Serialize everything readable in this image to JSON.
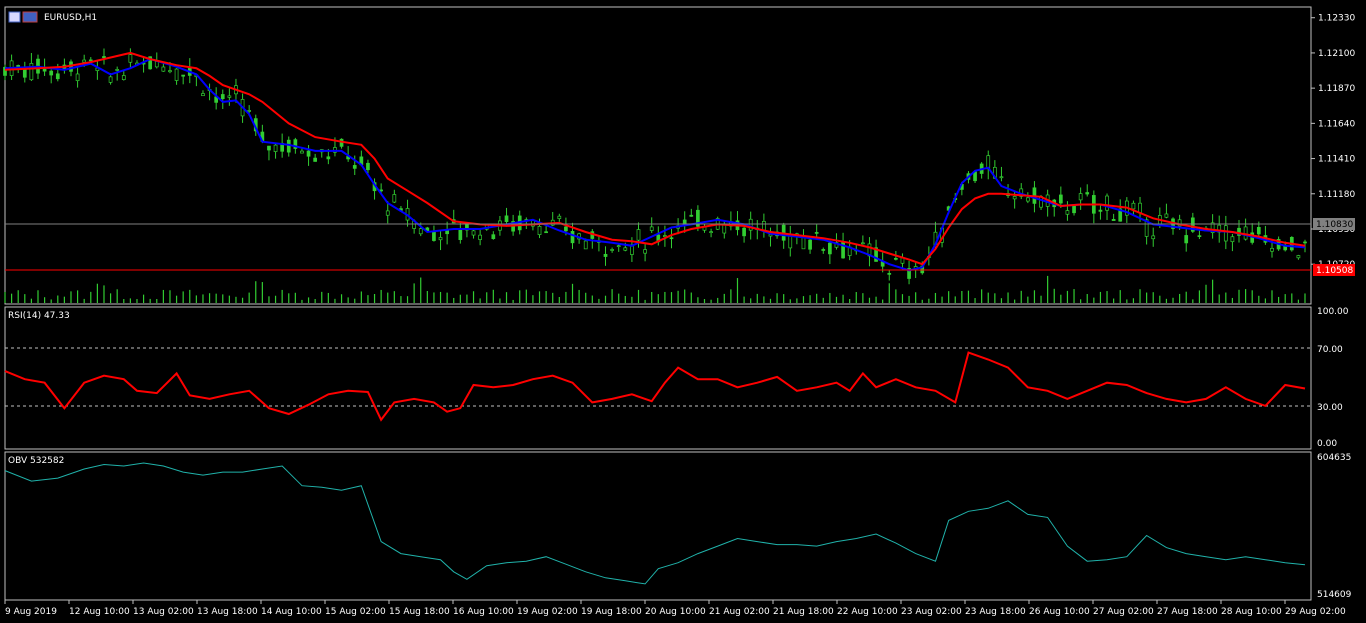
{
  "window": {
    "title": "EURUSD,H1"
  },
  "price_panel": {
    "price_ticks": [
      "1.12330",
      "1.12100",
      "1.11870",
      "1.11640",
      "1.11410",
      "1.11180",
      "1.10950",
      "1.10720"
    ],
    "current_bid_tag": "1.10830",
    "ask_line_tag": "1.10508"
  },
  "rsi_panel": {
    "label": "RSI(14) 47.33",
    "ticks": [
      "100.00",
      "70.00",
      "30.00",
      "0.00"
    ]
  },
  "obv_panel": {
    "label": "OBV 532582",
    "ticks": [
      "604635",
      "514609"
    ]
  },
  "time_axis": {
    "labels": [
      "9 Aug 2019",
      "12 Aug 10:00",
      "13 Aug 02:00",
      "13 Aug 18:00",
      "14 Aug 10:00",
      "15 Aug 02:00",
      "15 Aug 18:00",
      "16 Aug 10:00",
      "19 Aug 02:00",
      "19 Aug 18:00",
      "20 Aug 10:00",
      "21 Aug 02:00",
      "21 Aug 18:00",
      "22 Aug 10:00",
      "23 Aug 02:00",
      "23 Aug 18:00",
      "26 Aug 10:00",
      "27 Aug 02:00",
      "27 Aug 18:00",
      "28 Aug 10:00",
      "29 Aug 02:00"
    ]
  },
  "colors": {
    "background": "#000000",
    "candles": "#32cd32",
    "ma_fast": "#0000ff",
    "ma_slow": "#ff0000",
    "rsi_line": "#ff0000",
    "obv_line": "#20b2aa",
    "volume": "#32cd32",
    "bid_line": "#808080",
    "ask_line": "#ff0000"
  },
  "chart_data": [
    {
      "type": "line",
      "title": "EURUSD,H1",
      "ylim": [
        1.1046,
        1.124
      ],
      "series": [
        {
          "name": "",
          "points": [
            [
              0,
              1.12
            ],
            [
              5,
              1.1201
            ],
            [
              9,
              1.1199
            ],
            [
              13,
              1.1203
            ],
            [
              16,
              1.1196
            ],
            [
              19,
              1.12
            ],
            [
              22,
              1.1206
            ],
            [
              26,
              1.1201
            ],
            [
              29,
              1.1196
            ],
            [
              31,
              1.1186
            ],
            [
              33,
              1.1178
            ],
            [
              35,
              1.1179
            ],
            [
              37,
              1.117
            ],
            [
              39,
              1.1152
            ],
            [
              43,
              1.115
            ],
            [
              47,
              1.1146
            ],
            [
              51,
              1.1146
            ],
            [
              54,
              1.1137
            ],
            [
              56,
              1.1124
            ],
            [
              58,
              1.1112
            ],
            [
              61,
              1.1104
            ],
            [
              64,
              1.1093
            ],
            [
              68,
              1.1095
            ],
            [
              72,
              1.1095
            ],
            [
              76,
              1.1098
            ],
            [
              80,
              1.1101
            ],
            [
              84,
              1.1094
            ],
            [
              88,
              1.1088
            ],
            [
              92,
              1.1086
            ],
            [
              95,
              1.1084
            ],
            [
              98,
              1.109
            ],
            [
              101,
              1.1096
            ],
            [
              104,
              1.1098
            ],
            [
              108,
              1.1101
            ],
            [
              112,
              1.1098
            ],
            [
              116,
              1.1092
            ],
            [
              120,
              1.109
            ],
            [
              124,
              1.1088
            ],
            [
              128,
              1.1083
            ],
            [
              131,
              1.1078
            ],
            [
              134,
              1.1072
            ],
            [
              137,
              1.1068
            ],
            [
              139,
              1.107
            ],
            [
              141,
              1.1085
            ],
            [
              143,
              1.1106
            ],
            [
              145,
              1.1125
            ],
            [
              147,
              1.1133
            ],
            [
              149,
              1.1135
            ],
            [
              151,
              1.1123
            ],
            [
              154,
              1.1118
            ],
            [
              157,
              1.1114
            ],
            [
              160,
              1.111
            ],
            [
              163,
              1.1111
            ],
            [
              166,
              1.1111
            ],
            [
              170,
              1.1106
            ],
            [
              174,
              1.1098
            ],
            [
              178,
              1.1096
            ],
            [
              182,
              1.1094
            ],
            [
              186,
              1.1093
            ],
            [
              190,
              1.1089
            ],
            [
              194,
              1.1084
            ],
            [
              197,
              1.1083
            ]
          ]
        },
        {
          "name": "",
          "points": [
            [
              0,
              1.1199
            ],
            [
              5,
              1.12
            ],
            [
              9,
              1.1201
            ],
            [
              13,
              1.1204
            ],
            [
              16,
              1.1207
            ],
            [
              19,
              1.121
            ],
            [
              22,
              1.1206
            ],
            [
              26,
              1.1202
            ],
            [
              29,
              1.12
            ],
            [
              31,
              1.1195
            ],
            [
              33,
              1.1189
            ],
            [
              35,
              1.1186
            ],
            [
              37,
              1.1183
            ],
            [
              39,
              1.1178
            ],
            [
              43,
              1.1164
            ],
            [
              47,
              1.1155
            ],
            [
              51,
              1.1152
            ],
            [
              54,
              1.115
            ],
            [
              56,
              1.1141
            ],
            [
              58,
              1.1128
            ],
            [
              61,
              1.112
            ],
            [
              64,
              1.1112
            ],
            [
              68,
              1.11
            ],
            [
              72,
              1.1098
            ],
            [
              76,
              1.1097
            ],
            [
              80,
              1.1098
            ],
            [
              84,
              1.1099
            ],
            [
              88,
              1.1093
            ],
            [
              92,
              1.1088
            ],
            [
              95,
              1.1087
            ],
            [
              98,
              1.1085
            ],
            [
              101,
              1.1091
            ],
            [
              104,
              1.1095
            ],
            [
              108,
              1.1098
            ],
            [
              112,
              1.1097
            ],
            [
              116,
              1.1093
            ],
            [
              120,
              1.1091
            ],
            [
              124,
              1.1089
            ],
            [
              128,
              1.1086
            ],
            [
              131,
              1.1083
            ],
            [
              134,
              1.1079
            ],
            [
              137,
              1.1075
            ],
            [
              139,
              1.1072
            ],
            [
              141,
              1.1082
            ],
            [
              143,
              1.1096
            ],
            [
              145,
              1.1108
            ],
            [
              147,
              1.1115
            ],
            [
              149,
              1.1118
            ],
            [
              151,
              1.1118
            ],
            [
              154,
              1.1117
            ],
            [
              157,
              1.1116
            ],
            [
              160,
              1.111
            ],
            [
              163,
              1.1111
            ],
            [
              166,
              1.1111
            ],
            [
              170,
              1.1109
            ],
            [
              174,
              1.1102
            ],
            [
              178,
              1.1098
            ],
            [
              182,
              1.1095
            ],
            [
              186,
              1.1093
            ],
            [
              190,
              1.109
            ],
            [
              194,
              1.1086
            ],
            [
              197,
              1.1084
            ]
          ]
        }
      ]
    },
    {
      "type": "line",
      "title": "RSI(14) 47.33",
      "ylim": [
        0,
        100
      ],
      "series": [
        {
          "name": "RSI(14)",
          "points": [
            [
              0,
              62
            ],
            [
              3,
              55
            ],
            [
              6,
              52
            ],
            [
              9,
              30
            ],
            [
              12,
              52
            ],
            [
              15,
              58
            ],
            [
              18,
              55
            ],
            [
              20,
              45
            ],
            [
              23,
              43
            ],
            [
              26,
              60
            ],
            [
              28,
              41
            ],
            [
              31,
              38
            ],
            [
              34,
              42
            ],
            [
              37,
              45
            ],
            [
              40,
              30
            ],
            [
              43,
              25
            ],
            [
              46,
              33
            ],
            [
              49,
              42
            ],
            [
              52,
              45
            ],
            [
              55,
              44
            ],
            [
              57,
              20
            ],
            [
              59,
              35
            ],
            [
              62,
              38
            ],
            [
              65,
              35
            ],
            [
              67,
              27
            ],
            [
              69,
              30
            ],
            [
              71,
              50
            ],
            [
              74,
              48
            ],
            [
              77,
              50
            ],
            [
              80,
              55
            ],
            [
              83,
              58
            ],
            [
              86,
              52
            ],
            [
              89,
              35
            ],
            [
              92,
              38
            ],
            [
              95,
              42
            ],
            [
              98,
              36
            ],
            [
              100,
              52
            ],
            [
              102,
              65
            ],
            [
              105,
              55
            ],
            [
              108,
              55
            ],
            [
              111,
              48
            ],
            [
              114,
              52
            ],
            [
              117,
              57
            ],
            [
              120,
              45
            ],
            [
              123,
              48
            ],
            [
              126,
              52
            ],
            [
              128,
              45
            ],
            [
              130,
              60
            ],
            [
              132,
              48
            ],
            [
              135,
              55
            ],
            [
              138,
              48
            ],
            [
              141,
              45
            ],
            [
              144,
              35
            ],
            [
              146,
              78
            ],
            [
              149,
              72
            ],
            [
              152,
              65
            ],
            [
              155,
              48
            ],
            [
              158,
              45
            ],
            [
              161,
              38
            ],
            [
              164,
              45
            ],
            [
              167,
              52
            ],
            [
              170,
              50
            ],
            [
              173,
              43
            ],
            [
              176,
              38
            ],
            [
              179,
              35
            ],
            [
              182,
              38
            ],
            [
              185,
              48
            ],
            [
              188,
              38
            ],
            [
              191,
              32
            ],
            [
              194,
              50
            ],
            [
              197,
              47
            ]
          ]
        }
      ]
    },
    {
      "type": "line",
      "title": "OBV 532582",
      "ylim": [
        514609,
        604635
      ],
      "series": [
        {
          "name": "OBV",
          "points": [
            [
              0,
              595000
            ],
            [
              4,
              588000
            ],
            [
              8,
              590000
            ],
            [
              12,
              596000
            ],
            [
              15,
              599000
            ],
            [
              18,
              598000
            ],
            [
              21,
              600000
            ],
            [
              24,
              598000
            ],
            [
              27,
              594000
            ],
            [
              30,
              592000
            ],
            [
              33,
              594000
            ],
            [
              36,
              594000
            ],
            [
              39,
              596000
            ],
            [
              42,
              598000
            ],
            [
              45,
              585000
            ],
            [
              48,
              584000
            ],
            [
              51,
              582000
            ],
            [
              54,
              585000
            ],
            [
              57,
              548000
            ],
            [
              60,
              540000
            ],
            [
              63,
              538000
            ],
            [
              66,
              536000
            ],
            [
              68,
              528000
            ],
            [
              70,
              523000
            ],
            [
              73,
              532000
            ],
            [
              76,
              534000
            ],
            [
              79,
              535000
            ],
            [
              82,
              538000
            ],
            [
              85,
              533000
            ],
            [
              88,
              528000
            ],
            [
              91,
              524000
            ],
            [
              94,
              522000
            ],
            [
              97,
              520000
            ],
            [
              99,
              530000
            ],
            [
              102,
              534000
            ],
            [
              105,
              540000
            ],
            [
              108,
              545000
            ],
            [
              111,
              550000
            ],
            [
              114,
              548000
            ],
            [
              117,
              546000
            ],
            [
              120,
              546000
            ],
            [
              123,
              545000
            ],
            [
              126,
              548000
            ],
            [
              129,
              550000
            ],
            [
              132,
              553000
            ],
            [
              135,
              547000
            ],
            [
              138,
              540000
            ],
            [
              141,
              535000
            ],
            [
              143,
              562000
            ],
            [
              146,
              568000
            ],
            [
              149,
              570000
            ],
            [
              152,
              575000
            ],
            [
              155,
              566000
            ],
            [
              158,
              564000
            ],
            [
              161,
              545000
            ],
            [
              164,
              535000
            ],
            [
              167,
              536000
            ],
            [
              170,
              538000
            ],
            [
              173,
              552000
            ],
            [
              176,
              544000
            ],
            [
              179,
              540000
            ],
            [
              182,
              538000
            ],
            [
              185,
              536000
            ],
            [
              188,
              538000
            ],
            [
              191,
              536000
            ],
            [
              194,
              534000
            ],
            [
              197,
              532582
            ]
          ]
        }
      ]
    }
  ]
}
